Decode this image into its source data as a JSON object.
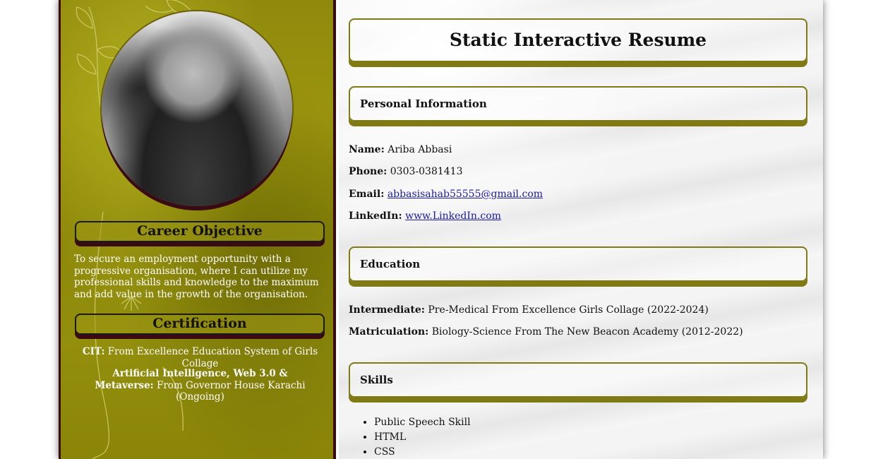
{
  "sidebar": {
    "career_heading": "Career Objective",
    "career_text": "To secure an employment opportunity with a progressive organisation, where I can utilize my professional skills and knowledge to the maximum and add value in the growth of the organisation.",
    "cert_heading": "Certification",
    "certifications": [
      {
        "label": "CIT:",
        "text": "From Excellence Education System of Girls Collage"
      },
      {
        "label": "Artificial Intelligence, Web 3.0 & Metaverse:",
        "text": "From Governor House Karachi (Ongoing)"
      }
    ]
  },
  "main": {
    "title": "Static Interactive Resume",
    "personal_heading": "Personal Information",
    "personal": {
      "name_label": "Name:",
      "name": "Ariba Abbasi",
      "phone_label": "Phone:",
      "phone": "0303-0381413",
      "email_label": "Email:",
      "email": "abbasisahab55555@gmail.com",
      "linkedin_label": "LinkedIn:",
      "linkedin": "www.LinkedIn.com"
    },
    "education_heading": "Education",
    "education": [
      {
        "label": "Intermediate:",
        "text": "Pre-Medical From Excellence Girls Collage (2022-2024)"
      },
      {
        "label": "Matriculation:",
        "text": "Biology-Science From The New Beacon Academy (2012-2022)"
      }
    ],
    "skills_heading": "Skills",
    "skills": [
      "Public Speech Skill",
      "HTML",
      "CSS"
    ]
  },
  "colors": {
    "sidebar_bg": "#938f0d",
    "dark_maroon": "#3b0b14",
    "box_border": "#7f7a14",
    "link": "#1a1aa6"
  }
}
